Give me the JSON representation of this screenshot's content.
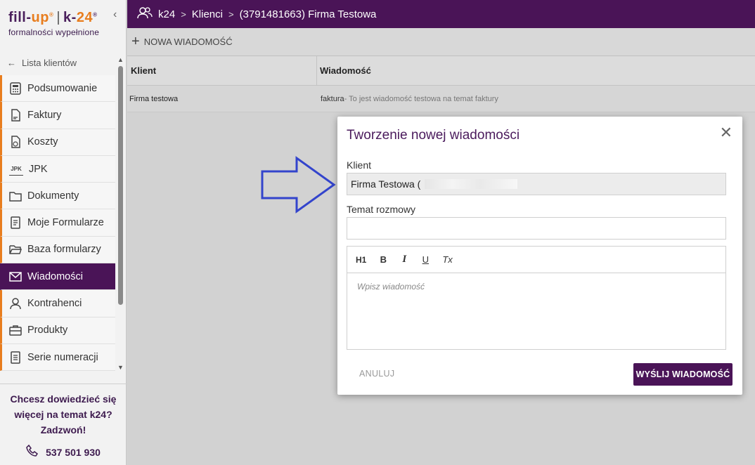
{
  "brand": {
    "logo_fill": "fill-",
    "logo_up": "up",
    "logo_k": "k-",
    "logo_24": "24",
    "tagline": "formalności wypełnione"
  },
  "sidebar": {
    "back_label": "Lista klientów",
    "items": [
      {
        "label": "Podsumowanie",
        "icon": "calculator-icon"
      },
      {
        "label": "Faktury",
        "icon": "invoice-icon"
      },
      {
        "label": "Koszty",
        "icon": "costs-icon"
      },
      {
        "label": "JPK",
        "icon": "jpk-icon"
      },
      {
        "label": "Dokumenty",
        "icon": "folder-icon"
      },
      {
        "label": "Moje Formularze",
        "icon": "form-icon"
      },
      {
        "label": "Baza formularzy",
        "icon": "folder-open-icon"
      },
      {
        "label": "Wiadomości",
        "icon": "mail-icon",
        "active": true
      },
      {
        "label": "Kontrahenci",
        "icon": "person-icon"
      },
      {
        "label": "Produkty",
        "icon": "briefcase-icon"
      },
      {
        "label": "Serie numeracji",
        "icon": "document-icon"
      }
    ],
    "promo_line1": "Chcesz dowiedzieć się",
    "promo_line2": "więcej na temat k24?",
    "promo_line3": "Zadzwoń!",
    "phone": "537 501 930"
  },
  "topbar": {
    "crumb1": "k24",
    "crumb2": "Klienci",
    "crumb3": "(3791481663) Firma Testowa"
  },
  "toolbar": {
    "new_message": "NOWA WIADOMOŚĆ"
  },
  "table": {
    "col_client": "Klient",
    "col_message": "Wiadomość",
    "rows": [
      {
        "client": "Firma testowa",
        "topic": "faktura",
        "excerpt": " - To jest wiadomość testowa na temat faktury"
      }
    ]
  },
  "modal": {
    "title": "Tworzenie nowej wiadomości",
    "client_label": "Klient",
    "client_value": "Firma Testowa (",
    "topic_label": "Temat rozmowy",
    "topic_value": "",
    "editor_placeholder": "Wpisz wiadomość",
    "toolbar": {
      "h1": "H1",
      "bold": "B",
      "italic": "I",
      "underline": "U",
      "clear": "Tx"
    },
    "cancel": "ANULUJ",
    "send": "WYŚLIJ WIADOMOŚĆ"
  },
  "colors": {
    "brand_purple": "#4a1457",
    "accent_orange": "#e87d1e",
    "arrow_blue": "#3344cc"
  }
}
